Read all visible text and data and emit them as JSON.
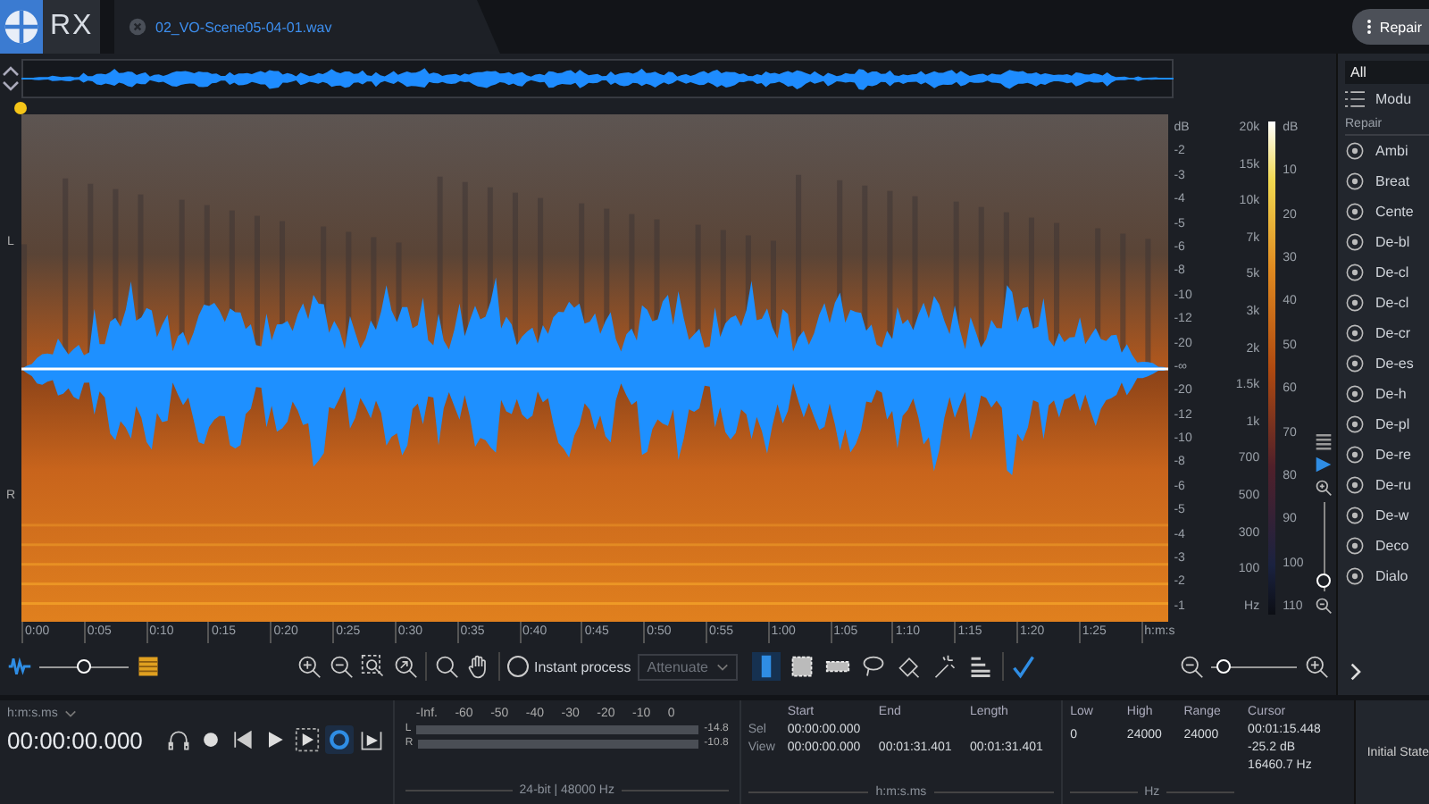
{
  "app": {
    "logo": "RX"
  },
  "file_tab": {
    "label": "02_VO-Scene05-04-01.wav"
  },
  "vertical_zoom_slider": {
    "level": 0.05
  },
  "module_button": {
    "label": "Repair"
  },
  "channels": [
    {
      "label": "L"
    },
    {
      "label": "R"
    }
  ],
  "amplitude_scale": [
    "dB",
    "-2",
    "-3",
    "-4",
    "-5",
    "-6",
    "-8",
    "-10",
    "-12",
    "-20",
    "-∞",
    "-20",
    "-12",
    "-10",
    "-8",
    "-6",
    "-5",
    "-4",
    "-3",
    "-2",
    "-1"
  ],
  "frequency_scale": [
    "20k",
    "15k",
    "10k",
    "7k",
    "5k",
    "3k",
    "2k",
    "1.5k",
    "1k",
    "700",
    "500",
    "300",
    "100",
    "Hz"
  ],
  "colormap_scale": [
    "dB",
    "10",
    "20",
    "30",
    "40",
    "50",
    "60",
    "70",
    "80",
    "90",
    "100",
    "110"
  ],
  "time_axis": [
    "0:00",
    "0:05",
    "0:10",
    "0:15",
    "0:20",
    "0:25",
    "0:30",
    "0:35",
    "0:40",
    "0:45",
    "0:50",
    "0:55",
    "1:00",
    "1:05",
    "1:10",
    "1:15",
    "1:20",
    "1:25",
    "h:m:s"
  ],
  "toolbar": {
    "blend_slider": {
      "level": 0.5
    },
    "instant_process": {
      "label": "Instant process",
      "checked": false
    },
    "mode_dropdown": {
      "value": "Attenuate",
      "disabled": true
    },
    "selection_tools": [
      {
        "kind": "time",
        "selected": true
      },
      {
        "kind": "rectangle",
        "selected": false
      },
      {
        "kind": "frequency",
        "selected": false
      },
      {
        "kind": "lasso",
        "selected": false
      },
      {
        "kind": "brush",
        "selected": false
      },
      {
        "kind": "wand",
        "selected": false
      },
      {
        "kind": "harmonic",
        "selected": false
      }
    ],
    "zoom_slider": {
      "level": 0.15
    }
  },
  "module_panel": {
    "filter": "All",
    "view_label": "Modu",
    "section": "Repair",
    "modules": [
      "Ambi",
      "Breat",
      "Cente",
      "De-bl",
      "De-cl",
      "De-cl",
      "De-cr",
      "De-es",
      "De-h",
      "De-pl",
      "De-re",
      "De-ru",
      "De-w",
      "Deco",
      "Dialo"
    ]
  },
  "transport": {
    "time_format": "h:m:s.ms",
    "time": "00:00:00.000",
    "buttons": [
      {
        "kind": "headphones",
        "selected": false
      },
      {
        "kind": "record",
        "selected": false
      },
      {
        "kind": "previous",
        "selected": false
      },
      {
        "kind": "play",
        "selected": false
      },
      {
        "kind": "play-selection",
        "selected": false
      },
      {
        "kind": "loop",
        "selected": true
      },
      {
        "kind": "export",
        "selected": false
      }
    ]
  },
  "meter": {
    "scale": [
      "-Inf.",
      "-60",
      "-50",
      "-40",
      "-30",
      "-20",
      "-10",
      "0"
    ],
    "channels": [
      {
        "label": "L",
        "reading": "-14.8"
      },
      {
        "label": "R",
        "reading": "-10.8"
      }
    ],
    "format": "24-bit | 48000 Hz"
  },
  "selection": {
    "headers": [
      "Start",
      "End",
      "Length"
    ],
    "rows": [
      {
        "label": "Sel",
        "start": "00:00:00.000"
      },
      {
        "label": "View",
        "start": "00:00:00.000",
        "end": "00:01:31.401",
        "length": "00:01:31.401"
      }
    ],
    "unit": "h:m:s.ms"
  },
  "frequency_range": {
    "headers": [
      "Low",
      "High",
      "Range"
    ],
    "values": [
      "0",
      "24000",
      "24000"
    ],
    "unit": "Hz"
  },
  "cursor": {
    "label": "Cursor",
    "time": "00:01:15.448",
    "amplitude": "-25.2 dB",
    "frequency": "16460.7 Hz"
  },
  "history": {
    "label": "Initial State"
  }
}
